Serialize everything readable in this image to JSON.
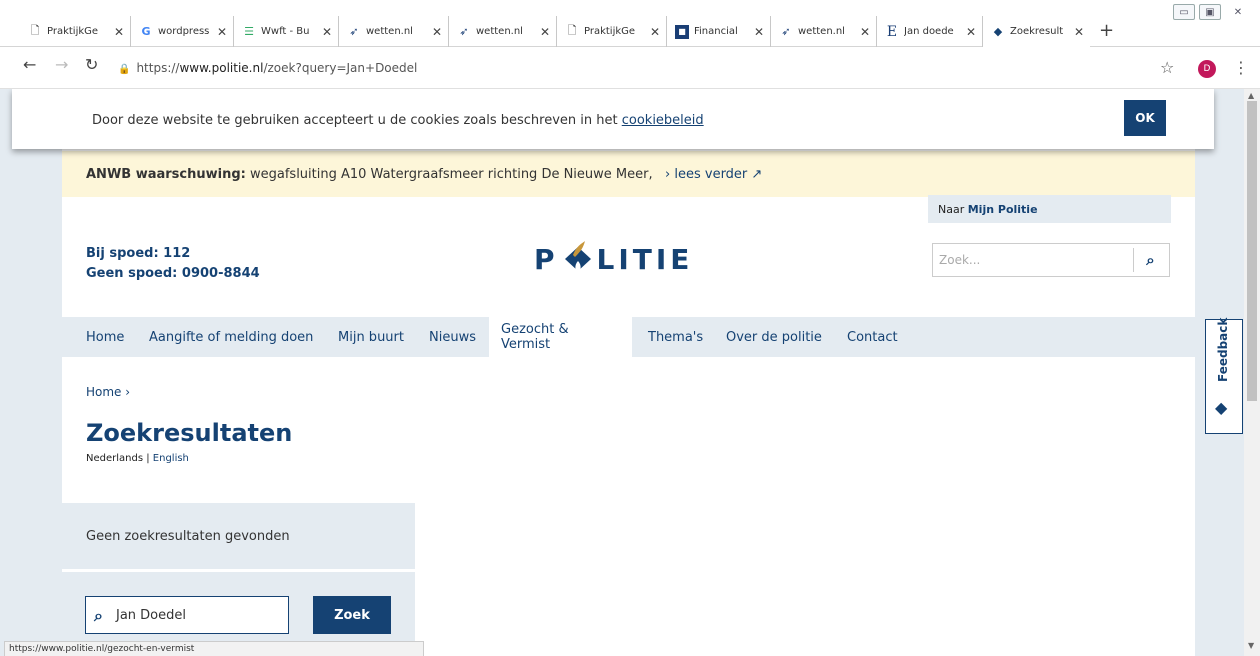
{
  "browser": {
    "tabs": [
      {
        "label": "PraktijkGe",
        "icon": "document-icon"
      },
      {
        "label": "wordpress",
        "icon": "google-icon"
      },
      {
        "label": "Wwft - Bu",
        "icon": "site-icon"
      },
      {
        "label": "wetten.nl",
        "icon": "wetten-icon"
      },
      {
        "label": "wetten.nl",
        "icon": "wetten-icon"
      },
      {
        "label": "PraktijkGe",
        "icon": "document-icon"
      },
      {
        "label": "Financial",
        "icon": "finance-icon"
      },
      {
        "label": "wetten.nl",
        "icon": "wetten-icon"
      },
      {
        "label": "Jan doede",
        "icon": "e-icon"
      },
      {
        "label": "Zoekresult",
        "icon": "politie-icon"
      }
    ],
    "url_prefix": "https://",
    "url_host": "www.politie.nl",
    "url_path": "/zoek?query=Jan+Doedel",
    "profile_initial": "D",
    "status_url": "https://www.politie.nl/gezocht-en-vermist"
  },
  "cookie": {
    "text": "Door deze website te gebruiken accepteert u de cookies zoals beschreven in het ",
    "link": "cookiebeleid",
    "ok": "OK"
  },
  "warning": {
    "label": "ANWB waarschuwing:",
    "text": " wegafsluiting  A10 Watergraafsmeer richting De Nieuwe Meer,",
    "more": "› lees verder"
  },
  "header": {
    "spoed": "Bij spoed: 112",
    "geen_spoed": "Geen spoed: 0900-8844",
    "logo_left": "P",
    "logo_right": "LITIE",
    "mijn_prefix": "Naar ",
    "mijn_link": "Mijn Politie",
    "search_placeholder": "Zoek..."
  },
  "nav": {
    "items": [
      "Home",
      "Aangifte of melding doen",
      "Mijn buurt",
      "Nieuws",
      "Gezocht & Vermist",
      "Thema's",
      "Over de politie",
      "Contact"
    ],
    "active": "Gezocht & Vermist"
  },
  "content": {
    "breadcrumb": "Home  ›",
    "title": "Zoekresultaten",
    "lang_nl": "Nederlands",
    "lang_sep": " | ",
    "lang_en": "English",
    "no_results": "Geen zoekresultaten gevonden",
    "query": "Jan Doedel",
    "zoek_button": "Zoek"
  },
  "feedback": {
    "label": "Feedback"
  },
  "colors": {
    "brand": "#154273",
    "warning_bg": "#fdf6d9",
    "panel_bg": "#e4ebf1"
  }
}
